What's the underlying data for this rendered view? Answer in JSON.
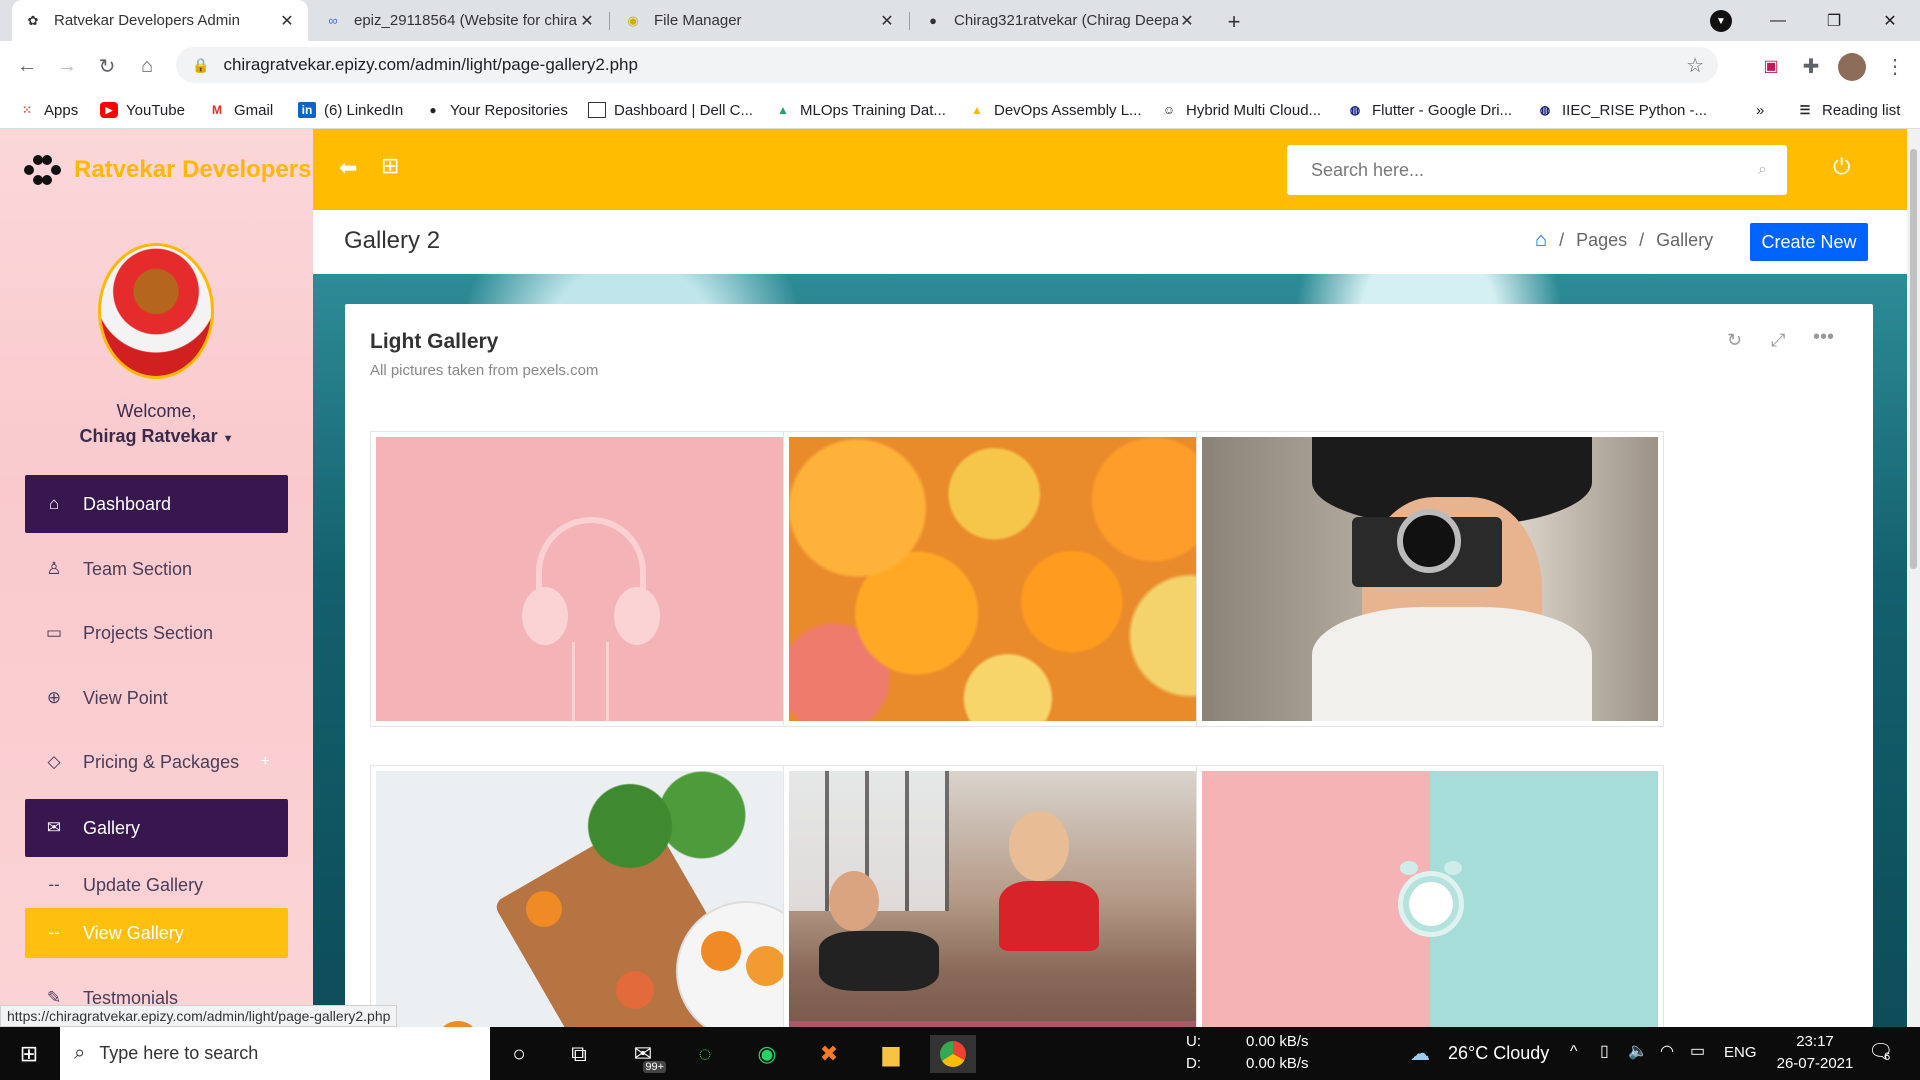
{
  "browser": {
    "tabs": [
      {
        "title": "Ratvekar Developers Admin",
        "active": true,
        "icon": "gear-flower-icon"
      },
      {
        "title": "epiz_29118564 (Website for chira",
        "active": false,
        "icon": "infinity-icon"
      },
      {
        "title": "File Manager",
        "active": false,
        "icon": "file-manager-icon"
      },
      {
        "title": "Chirag321ratvekar (Chirag Deepa",
        "active": false,
        "icon": "github-icon"
      }
    ],
    "new_tab": "+",
    "url": "chiragratvekar.epizy.com/admin/light/page-gallery2.php",
    "bookmarks": [
      {
        "label": "Apps",
        "icon": "apps-grid-icon"
      },
      {
        "label": "YouTube",
        "icon": "youtube-icon"
      },
      {
        "label": "Gmail",
        "icon": "gmail-icon"
      },
      {
        "label": "(6) LinkedIn",
        "icon": "linkedin-icon"
      },
      {
        "label": "Your Repositories",
        "icon": "github-icon"
      },
      {
        "label": "Dashboard | Dell C...",
        "icon": "dell-icon"
      },
      {
        "label": "MLOps Training Dat...",
        "icon": "google-drive-icon"
      },
      {
        "label": "DevOps Assembly L...",
        "icon": "google-drive-icon"
      },
      {
        "label": "Hybrid Multi Cloud...",
        "icon": "person-icon"
      },
      {
        "label": "Flutter - Google Dri...",
        "icon": "globe-icon"
      },
      {
        "label": "IIEC_RISE Python -...",
        "icon": "globe-icon"
      }
    ],
    "bookmarks_more": "»",
    "reading_list": "Reading list",
    "status_url": "https://chiragratvekar.epizy.com/admin/light/page-gallery2.php"
  },
  "sidebar": {
    "brand": "Ratvekar Developers",
    "welcome": "Welcome,",
    "user": "Chirag Ratvekar",
    "items": [
      {
        "label": "Dashboard",
        "icon": "home-icon",
        "style": "dark"
      },
      {
        "label": "Team Section",
        "icon": "user-icon",
        "style": "plain"
      },
      {
        "label": "Projects Section",
        "icon": "monitor-icon",
        "style": "plain"
      },
      {
        "label": "View Point",
        "icon": "crosshair-icon",
        "style": "plain"
      },
      {
        "label": "Pricing & Packages",
        "icon": "diamond-icon",
        "style": "plain"
      },
      {
        "label": "Gallery",
        "icon": "envelope-icon",
        "style": "dark"
      },
      {
        "label": "Update Gallery",
        "icon": "dash-icon",
        "style": "sub"
      },
      {
        "label": "View Gallery",
        "icon": "dash-icon",
        "style": "yellow"
      },
      {
        "label": "Testmonials",
        "icon": "pencil-icon",
        "style": "plain"
      }
    ]
  },
  "topbar": {
    "search_placeholder": "Search here..."
  },
  "page": {
    "title": "Gallery 2",
    "breadcrumb": [
      "Pages",
      "Gallery"
    ],
    "breadcrumb_sep": "/",
    "create_button": "Create New"
  },
  "card": {
    "title": "Light Gallery",
    "subtitle": "All pictures taken from pexels.com",
    "images": [
      {
        "subject": "headphones-on-pink"
      },
      {
        "subject": "citrus-slices"
      },
      {
        "subject": "woman-with-camera"
      },
      {
        "subject": "fruit-on-board"
      },
      {
        "subject": "women-exercising"
      },
      {
        "subject": "alarm-clock-on-pink-and-teal"
      }
    ]
  },
  "taskbar": {
    "search_placeholder": "Type here to search",
    "mail_badge": "99+",
    "net_upload_label": "U:",
    "net_upload": "0.00 kB/s",
    "net_download_label": "D:",
    "net_download": "0.00 kB/s",
    "weather": "26°C  Cloudy",
    "language": "ENG",
    "time": "23:17",
    "date": "26-07-2021",
    "notifications": "6"
  }
}
